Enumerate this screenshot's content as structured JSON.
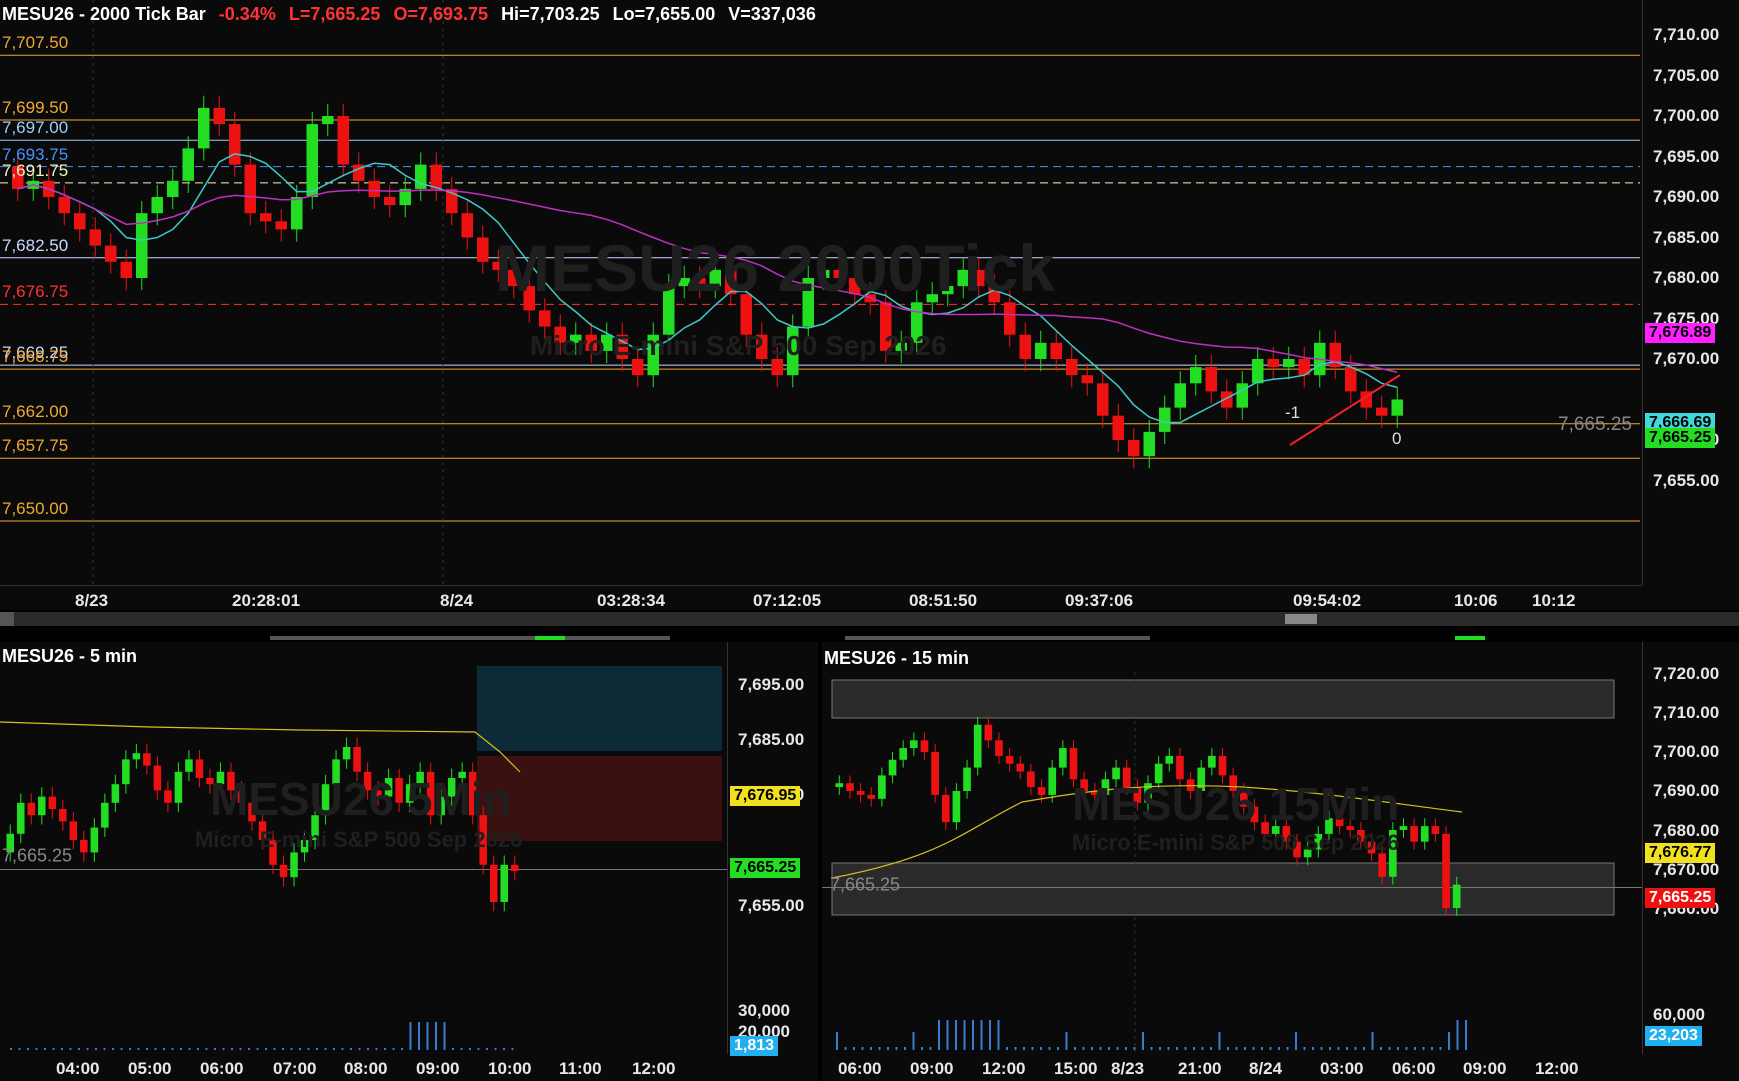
{
  "main": {
    "symbol": "MESU26 - 2000 Tick Bar",
    "change": "-0.34%",
    "last": "L=7,665.25",
    "open": "O=7,693.75",
    "high": "Hi=7,703.25",
    "low": "Lo=7,655.00",
    "volume": "V=337,036",
    "watermark": "MESU26 2000Tick",
    "watermark_sub": "Micro E-mini S&P 500 Sep 2026",
    "y_ticks": [
      "7,710.00",
      "7,705.00",
      "7,700.00",
      "7,695.00",
      "7,690.00",
      "7,685.00",
      "7,680.00",
      "7,675.00",
      "7,670.00",
      "7,660.00",
      "7,655.00"
    ],
    "x_ticks": [
      "8/23",
      "20:28:01",
      "8/24",
      "03:28:34",
      "07:12:05",
      "08:51:50",
      "09:37:06",
      "09:54:02",
      "10:06",
      "10:12"
    ],
    "levels": [
      {
        "label": "7,707.50",
        "color": "#f0a830"
      },
      {
        "label": "7,699.50",
        "color": "#f0a830"
      },
      {
        "label": "7,697.00",
        "color": "#9ad0ff"
      },
      {
        "label": "7,693.75",
        "color": "#4a90ff"
      },
      {
        "label": "7,691.75",
        "color": "#f5f5c0"
      },
      {
        "label": "7,682.50",
        "color": "#c8d8ff"
      },
      {
        "label": "7,676.75",
        "color": "#ff3030"
      },
      {
        "label": "7,669.25",
        "color": "#c8d8ff"
      },
      {
        "label": "7,668.75",
        "color": "#f0a830"
      },
      {
        "label": "7,662.00",
        "color": "#f0a830"
      },
      {
        "label": "7,657.75",
        "color": "#f0a830"
      },
      {
        "label": "7,650.00",
        "color": "#f0a830"
      }
    ],
    "badge_ma_slow": "7,676.89",
    "badge_ma_fast": "7,666.69",
    "badge_price": "7,665.25",
    "price_ghost": "7,665.25",
    "annot_a": "-1",
    "annot_b": "0"
  },
  "lower_left": {
    "title": "MESU26 - 5 min",
    "watermark": "MESU26 5Min",
    "watermark_sub": "Micro E-mini S&P 500 Sep 2026",
    "y_ticks": [
      "7,695.00",
      "7,685.00",
      "7,675.00",
      "7,655.00",
      "30,000",
      "20,000"
    ],
    "x_ticks": [
      "04:00",
      "05:00",
      "06:00",
      "07:00",
      "08:00",
      "09:00",
      "10:00",
      "11:00",
      "12:00"
    ],
    "badge_ma": "7,676.95",
    "badge_price": "7,665.25",
    "badge_volume": "1,813",
    "price_ghost": "7,665.25"
  },
  "lower_right": {
    "title": "MESU26 - 15 min",
    "watermark": "MESU26 15Min",
    "watermark_sub": "Micro E-mini S&P 500 Sep 2026",
    "y_ticks": [
      "7,720.00",
      "7,710.00",
      "7,700.00",
      "7,690.00",
      "7,680.00",
      "7,670.00",
      "7,660.00",
      "60,000"
    ],
    "x_ticks": [
      "06:00",
      "09:00",
      "12:00",
      "15:00",
      "8/23",
      "21:00",
      "8/24",
      "03:00",
      "06:00",
      "09:00",
      "12:00"
    ],
    "badge_ma": "7,676.77",
    "badge_price": "7,665.25",
    "badge_volume": "23,203",
    "price_ghost": "7,665.25"
  },
  "colors": {
    "up": "#22dd22",
    "down": "#ee1111",
    "ma_fast": "#40c8c8",
    "ma_slow": "#c030c0",
    "ma_5": "#d8c020"
  }
}
